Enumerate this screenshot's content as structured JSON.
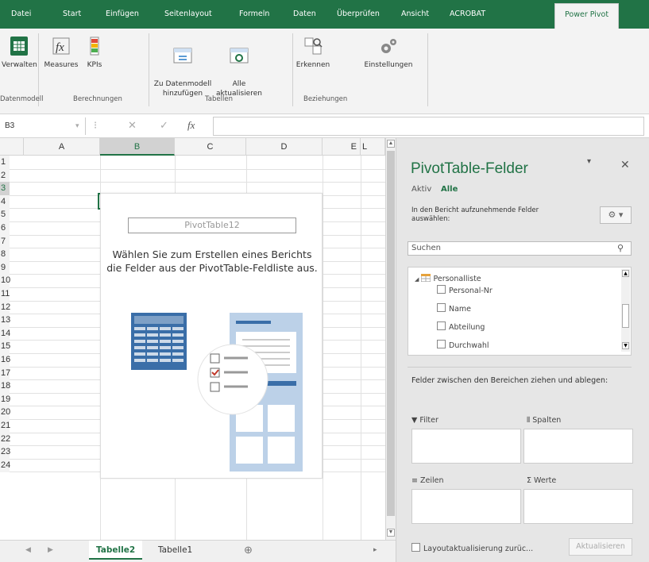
{
  "ribbon_tabs": [
    "Datei",
    "Start",
    "Einfügen",
    "Seitenlayout",
    "Formeln",
    "Daten",
    "Überprüfen",
    "Ansicht",
    "ACROBAT",
    "Power Pivot"
  ],
  "ribbon": {
    "verwalten": "Verwalten",
    "measures": "Measures",
    "kpis": "KPIs",
    "zu_datenmodell": "Zu Datenmodell\nhinzufügen",
    "alle_aktualisieren": "Alle\naktualisieren",
    "erkennen": "Erkennen",
    "einstellungen": "Einstellungen",
    "group_datenmodell": "Datenmodell",
    "group_berechnungen": "Berechnungen",
    "group_tabellen": "Tabellen",
    "group_beziehungen": "Beziehungen"
  },
  "namebox": "B3",
  "formula_value": "",
  "columns": [
    "A",
    "B",
    "C",
    "D",
    "E",
    "L"
  ],
  "rows": [
    "1",
    "2",
    "3",
    "4",
    "5",
    "6",
    "7",
    "8",
    "9",
    "10",
    "11",
    "12",
    "13",
    "14",
    "15",
    "16",
    "17",
    "18",
    "19",
    "20",
    "21",
    "22",
    "23",
    "24"
  ],
  "pivot": {
    "name": "PivotTable12",
    "message": "Wählen Sie zum Erstellen eines Berichts die Felder aus der PivotTable-Feldliste aus."
  },
  "sheets": [
    "Tabelle2",
    "Tabelle1"
  ],
  "add_sheet": "⊕",
  "pane": {
    "title": "PivotTable-Felder",
    "tab_active": "Aktiv",
    "tab_all": "Alle",
    "description": "In den Bericht aufzunehmende Felder auswählen:",
    "search_placeholder": "Suchen",
    "table_name": "Personalliste",
    "fields": [
      "Personal-Nr",
      "Name",
      "Abteilung",
      "Durchwahl"
    ],
    "drag_message": "Felder zwischen den Bereichen ziehen und ablegen:",
    "area_filter": "Filter",
    "area_columns": "Spalten",
    "area_rows": "Zeilen",
    "area_values": "Werte",
    "defer_label": "Layoutaktualisierung zurüc...",
    "update_button": "Aktualisieren"
  },
  "colors": {
    "excel_green": "#217346"
  }
}
